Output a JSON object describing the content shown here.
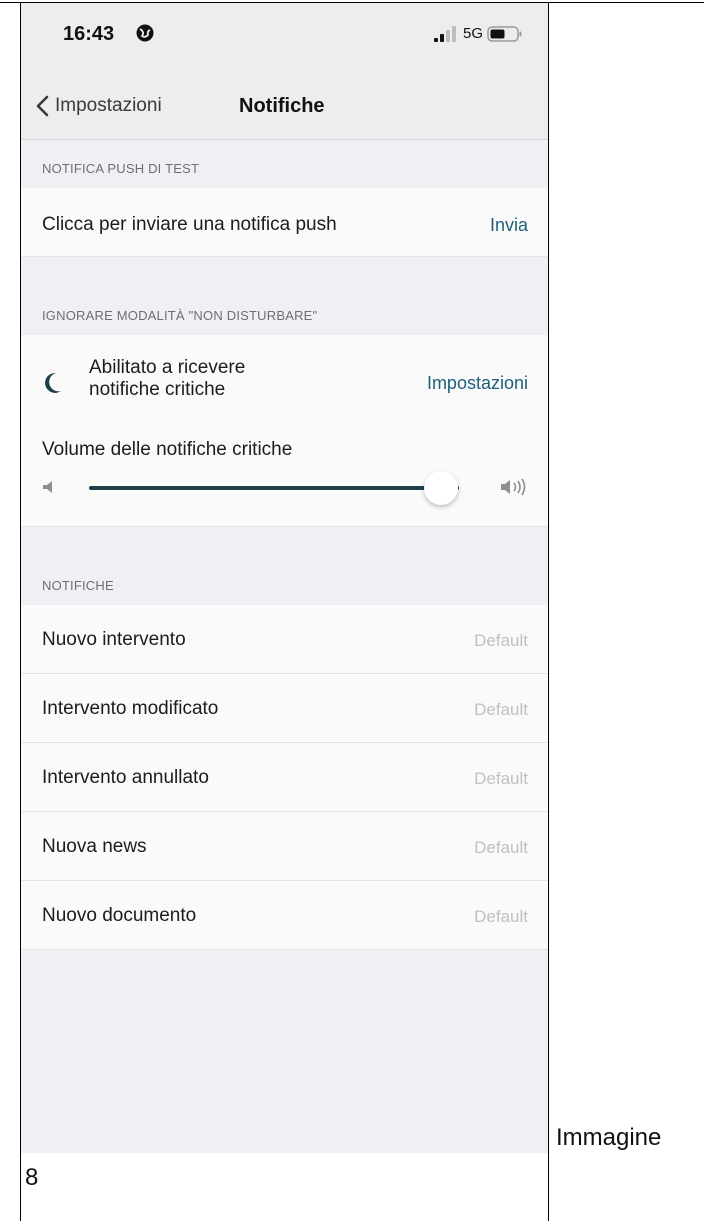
{
  "status_bar": {
    "time": "16:43",
    "network": "5G"
  },
  "nav": {
    "back_label": "Impostazioni",
    "title": "Notifiche"
  },
  "sections": {
    "test_push": {
      "header": "NOTIFICA PUSH DI TEST",
      "row_label": "Clicca per inviare una notifica push",
      "action": "Invia"
    },
    "dnd_override": {
      "header": "IGNORARE MODALITÀ \"NON DISTURBARE\"",
      "critical_label": "Abilitato a ricevere notifiche critiche",
      "settings_link": "Impostazioni",
      "volume_label": "Volume delle notifiche critiche",
      "volume_level": 0.95
    },
    "notifications": {
      "header": "NOTIFICHE",
      "items": [
        {
          "label": "Nuovo intervento",
          "value": "Default"
        },
        {
          "label": "Intervento modificato",
          "value": "Default"
        },
        {
          "label": "Intervento annullato",
          "value": "Default"
        },
        {
          "label": "Nuova news",
          "value": "Default"
        },
        {
          "label": "Nuovo documento",
          "value": "Default"
        }
      ]
    }
  },
  "caption": {
    "line1": "Immagine",
    "line2": "8"
  },
  "colors": {
    "accent": "#1f5f7a",
    "slider": "#1f3f4a",
    "background": "#efeff4"
  }
}
